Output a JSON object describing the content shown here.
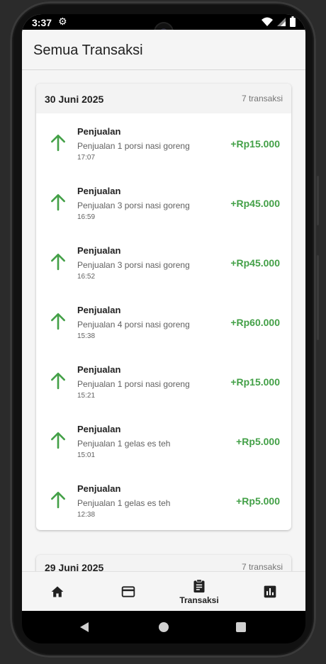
{
  "status_bar": {
    "time": "3:37",
    "settings_icon": "gear-icon",
    "icons": [
      "wifi-icon",
      "signal-icon",
      "battery-icon"
    ]
  },
  "app_bar": {
    "title": "Semua Transaksi"
  },
  "colors": {
    "income": "#43a047",
    "fab": "#757575",
    "header_bg": "#f3f3f3"
  },
  "groups": [
    {
      "date": "30 Juni 2025",
      "count": "7 transaksi",
      "transactions": [
        {
          "title": "Penjualan",
          "description": "Penjualan 1 porsi nasi goreng",
          "time": "17:07",
          "amount": "+Rp15.000",
          "icon": "arrow-up-icon"
        },
        {
          "title": "Penjualan",
          "description": "Penjualan 3 porsi nasi goreng",
          "time": "16:59",
          "amount": "+Rp45.000",
          "icon": "arrow-up-icon"
        },
        {
          "title": "Penjualan",
          "description": "Penjualan 3 porsi nasi goreng",
          "time": "16:52",
          "amount": "+Rp45.000",
          "icon": "arrow-up-icon"
        },
        {
          "title": "Penjualan",
          "description": "Penjualan 4 porsi nasi goreng",
          "time": "15:38",
          "amount": "+Rp60.000",
          "icon": "arrow-up-icon"
        },
        {
          "title": "Penjualan",
          "description": "Penjualan 1 porsi nasi goreng",
          "time": "15:21",
          "amount": "+Rp15.000",
          "icon": "arrow-up-icon"
        },
        {
          "title": "Penjualan",
          "description": "Penjualan 1 gelas es teh",
          "time": "15:01",
          "amount": "+Rp5.000",
          "icon": "arrow-up-icon"
        },
        {
          "title": "Penjualan",
          "description": "Penjualan 1 gelas es teh",
          "time": "12:38",
          "amount": "+Rp5.000",
          "icon": "arrow-up-icon"
        }
      ]
    },
    {
      "date": "29 Juni 2025",
      "count": "7 transaksi"
    }
  ],
  "fabs": {
    "search_icon": "search-icon",
    "add_icon": "plus-icon"
  },
  "bottom_nav": [
    {
      "icon": "home-icon",
      "label": ""
    },
    {
      "icon": "card-icon",
      "label": ""
    },
    {
      "icon": "clipboard-icon",
      "label": "Transaksi",
      "active": true
    },
    {
      "icon": "bar-chart-icon",
      "label": ""
    }
  ],
  "system_nav": [
    "back-icon",
    "home-circle-icon",
    "recents-icon"
  ]
}
